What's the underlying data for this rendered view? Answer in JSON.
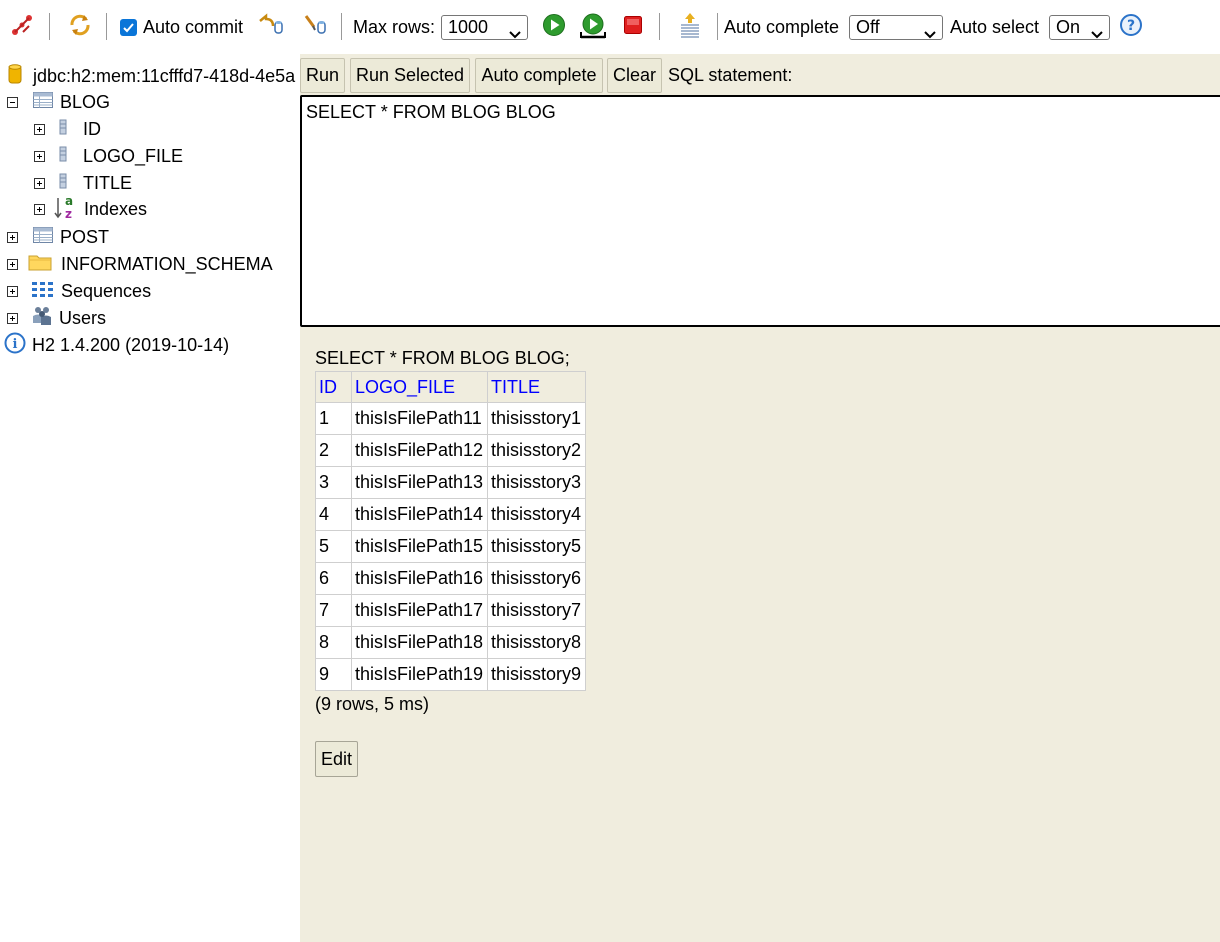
{
  "toolbar": {
    "auto_commit_label": "Auto commit",
    "max_rows_label": "Max rows:",
    "max_rows_value": "1000",
    "auto_complete_label": "Auto complete",
    "auto_complete_value": "Off",
    "auto_select_label": "Auto select",
    "auto_select_value": "On"
  },
  "tree": {
    "connection": "jdbc:h2:mem:11cfffd7-418d-4e5a",
    "blog": "BLOG",
    "col_id": "ID",
    "col_logo_file": "LOGO_FILE",
    "col_title": "TITLE",
    "indexes": "Indexes",
    "post": "POST",
    "information_schema": "INFORMATION_SCHEMA",
    "sequences": "Sequences",
    "users": "Users",
    "version": "H2 1.4.200 (2019-10-14)"
  },
  "query": {
    "run_label": "Run",
    "run_selected_label": "Run Selected",
    "auto_complete_label": "Auto complete",
    "clear_label": "Clear",
    "sql_statement_label": "SQL statement:",
    "sql_text": "SELECT * FROM BLOG BLOG"
  },
  "result": {
    "statement": "SELECT * FROM BLOG BLOG;",
    "columns": [
      "ID",
      "LOGO_FILE",
      "TITLE"
    ],
    "rows": [
      [
        "1",
        "thisIsFilePath11",
        "thisisstory1"
      ],
      [
        "2",
        "thisIsFilePath12",
        "thisisstory2"
      ],
      [
        "3",
        "thisIsFilePath13",
        "thisisstory3"
      ],
      [
        "4",
        "thisIsFilePath14",
        "thisisstory4"
      ],
      [
        "5",
        "thisIsFilePath15",
        "thisisstory5"
      ],
      [
        "6",
        "thisIsFilePath16",
        "thisisstory6"
      ],
      [
        "7",
        "thisIsFilePath17",
        "thisisstory7"
      ],
      [
        "8",
        "thisIsFilePath18",
        "thisisstory8"
      ],
      [
        "9",
        "thisIsFilePath19",
        "thisisstory9"
      ]
    ],
    "summary": "(9 rows, 5 ms)",
    "edit_label": "Edit"
  },
  "colors": {
    "panel_bg": "#f0edde",
    "header_link": "#0000ff",
    "run_green": "#2e9b2e",
    "stop_red": "#e02020",
    "help_blue": "#2b73c9"
  }
}
